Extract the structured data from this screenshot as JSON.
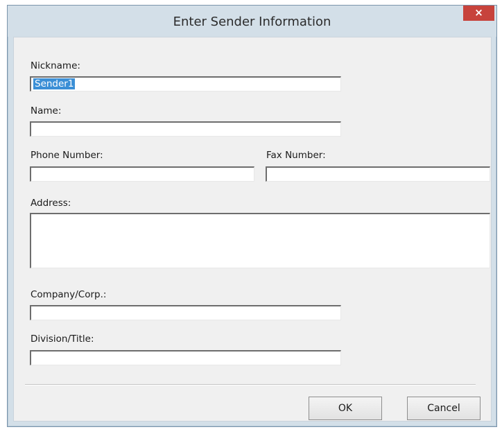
{
  "dialog": {
    "title": "Enter Sender Information",
    "close_symbol": "×"
  },
  "form": {
    "nickname_label": "Nickname:",
    "nickname_value": "Sender1",
    "name_label": "Name:",
    "name_value": "",
    "phone_label": "Phone Number:",
    "phone_value": "",
    "fax_label": "Fax Number:",
    "fax_value": "",
    "address_label": "Address:",
    "address_value": "",
    "company_label": "Company/Corp.:",
    "company_value": "",
    "division_label": "Division/Title:",
    "division_value": ""
  },
  "buttons": {
    "ok_label": "OK",
    "cancel_label": "Cancel"
  },
  "colors": {
    "title_bar": "#d3dfe8",
    "close_button": "#c7433c",
    "selection": "#3b8fd6",
    "dialog_body": "#f0f0f0"
  }
}
